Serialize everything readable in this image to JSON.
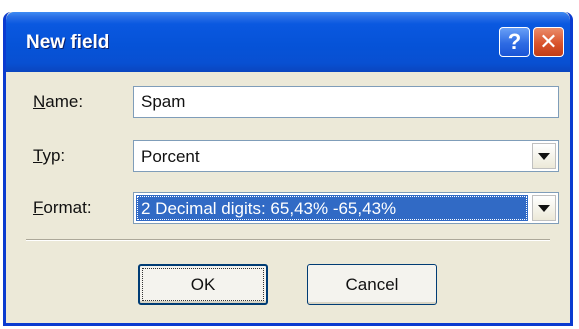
{
  "window": {
    "title": "New field",
    "help_symbol": "?",
    "close_symbol": "✕"
  },
  "form": {
    "name_label_mnemonic": "N",
    "name_label_rest": "ame:",
    "name_value": "Spam",
    "type_label_mnemonic": "T",
    "type_label_rest": "yp:",
    "type_value": "Porcent",
    "format_label_mnemonic": "F",
    "format_label_rest": "ormat:",
    "format_value": "2 Decimal digits: 65,43% -65,43%"
  },
  "buttons": {
    "ok_label": "OK",
    "cancel_label": "Cancel"
  },
  "icons": [
    "help-icon",
    "close-icon",
    "dropdown-arrow-icon"
  ]
}
